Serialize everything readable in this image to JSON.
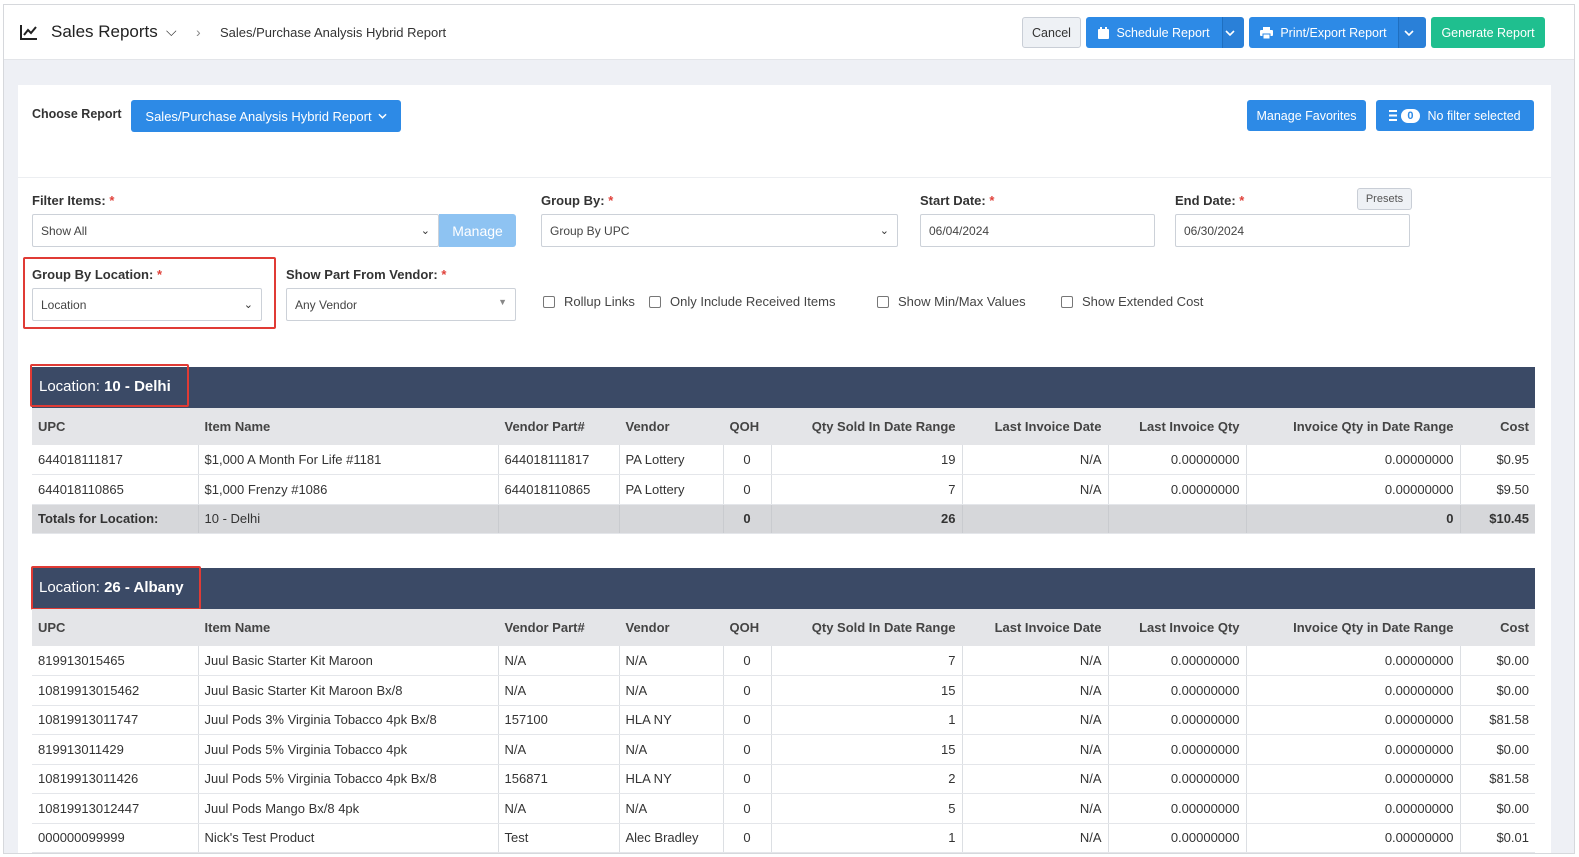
{
  "header": {
    "title": "Sales Reports",
    "breadcrumb": "Sales/Purchase Analysis Hybrid Report",
    "cancel": "Cancel",
    "schedule": "Schedule Report",
    "print": "Print/Export Report",
    "generate": "Generate Report"
  },
  "controls": {
    "choose_label": "Choose Report",
    "report_select": "Sales/Purchase Analysis Hybrid Report",
    "manage_favorites": "Manage Favorites",
    "filter_count": "0",
    "filter_text": "No filter selected",
    "filter_items_label": "Filter Items:",
    "filter_items_value": "Show All",
    "manage": "Manage",
    "group_by_label": "Group By:",
    "group_by_value": "Group By UPC",
    "start_date_label": "Start Date:",
    "start_date": "06/04/2024",
    "end_date_label": "End Date:",
    "end_date": "06/30/2024",
    "presets": "Presets",
    "group_location_label": "Group By Location:",
    "group_location_value": "Location",
    "vendor_label": "Show Part From Vendor:",
    "vendor_value": "Any Vendor",
    "checkboxes": [
      "Rollup Links",
      "Only Include Received Items",
      "Show Min/Max Values",
      "Show Extended Cost"
    ],
    "required_mark": "*"
  },
  "columns": [
    "UPC",
    "Item Name",
    "Vendor Part#",
    "Vendor",
    "QOH",
    "Qty Sold In Date Range",
    "Last Invoice Date",
    "Last Invoice Qty",
    "Invoice Qty in Date Range",
    "Cost"
  ],
  "sections": [
    {
      "location_prefix": "Location:",
      "location": "10 - Delhi",
      "rows": [
        [
          "644018111817",
          "$1,000 A Month For Life #1181",
          "644018111817",
          "PA Lottery",
          "0",
          "19",
          "N/A",
          "0.00000000",
          "0.00000000",
          "$0.95"
        ],
        [
          "644018110865",
          "$1,000 Frenzy #1086",
          "644018110865",
          "PA Lottery",
          "0",
          "7",
          "N/A",
          "0.00000000",
          "0.00000000",
          "$9.50"
        ]
      ],
      "totals": {
        "label": "Totals for Location:",
        "location": "10 - Delhi",
        "qoh": "0",
        "qty_sold": "26",
        "invoice_qty": "0",
        "cost": "$10.45"
      }
    },
    {
      "location_prefix": "Location:",
      "location": "26 - Albany",
      "rows": [
        [
          "819913015465",
          "Juul Basic Starter Kit Maroon",
          "N/A",
          "N/A",
          "0",
          "7",
          "N/A",
          "0.00000000",
          "0.00000000",
          "$0.00"
        ],
        [
          "10819913015462",
          "Juul Basic Starter Kit Maroon Bx/8",
          "N/A",
          "N/A",
          "0",
          "15",
          "N/A",
          "0.00000000",
          "0.00000000",
          "$0.00"
        ],
        [
          "10819913011747",
          "Juul Pods 3% Virginia Tobacco 4pk Bx/8",
          "157100",
          "HLA NY",
          "0",
          "1",
          "N/A",
          "0.00000000",
          "0.00000000",
          "$81.58"
        ],
        [
          "819913011429",
          "Juul Pods 5% Virginia Tobacco 4pk",
          "N/A",
          "N/A",
          "0",
          "15",
          "N/A",
          "0.00000000",
          "0.00000000",
          "$0.00"
        ],
        [
          "10819913011426",
          "Juul Pods 5% Virginia Tobacco 4pk Bx/8",
          "156871",
          "HLA NY",
          "0",
          "2",
          "N/A",
          "0.00000000",
          "0.00000000",
          "$81.58"
        ],
        [
          "10819913012447",
          "Juul Pods Mango Bx/8 4pk",
          "N/A",
          "N/A",
          "0",
          "5",
          "N/A",
          "0.00000000",
          "0.00000000",
          "$0.00"
        ],
        [
          "000000099999",
          "Nick's Test Product",
          "Test",
          "Alec Bradley",
          "0",
          "1",
          "N/A",
          "0.00000000",
          "0.00000000",
          "$0.01"
        ]
      ]
    }
  ]
}
